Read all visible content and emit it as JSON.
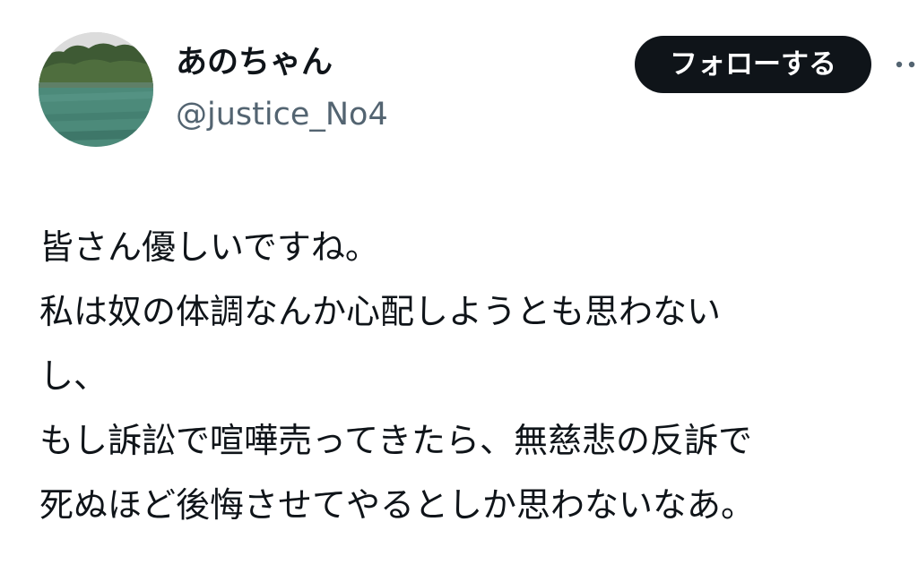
{
  "author": {
    "display_name": "あのちゃん",
    "handle": "@justice_No4",
    "avatar_icon": "landscape-lake-avatar"
  },
  "follow_button": {
    "label": "フォローする"
  },
  "more_menu": {
    "icon": "more-options-icon"
  },
  "tweet": {
    "lines": [
      "皆さん優しいですね。",
      "私は奴の体調なんか心配しようとも思わない",
      "し、",
      "もし訴訟で喧嘩売ってきたら、無慈悲の反訴で",
      "死ぬほど後悔させてやるとしか思わないなあ。"
    ]
  },
  "colors": {
    "text_primary": "#0f1419",
    "text_secondary": "#536471",
    "button_bg": "#0f1419",
    "button_text": "#ffffff",
    "background": "#ffffff"
  }
}
